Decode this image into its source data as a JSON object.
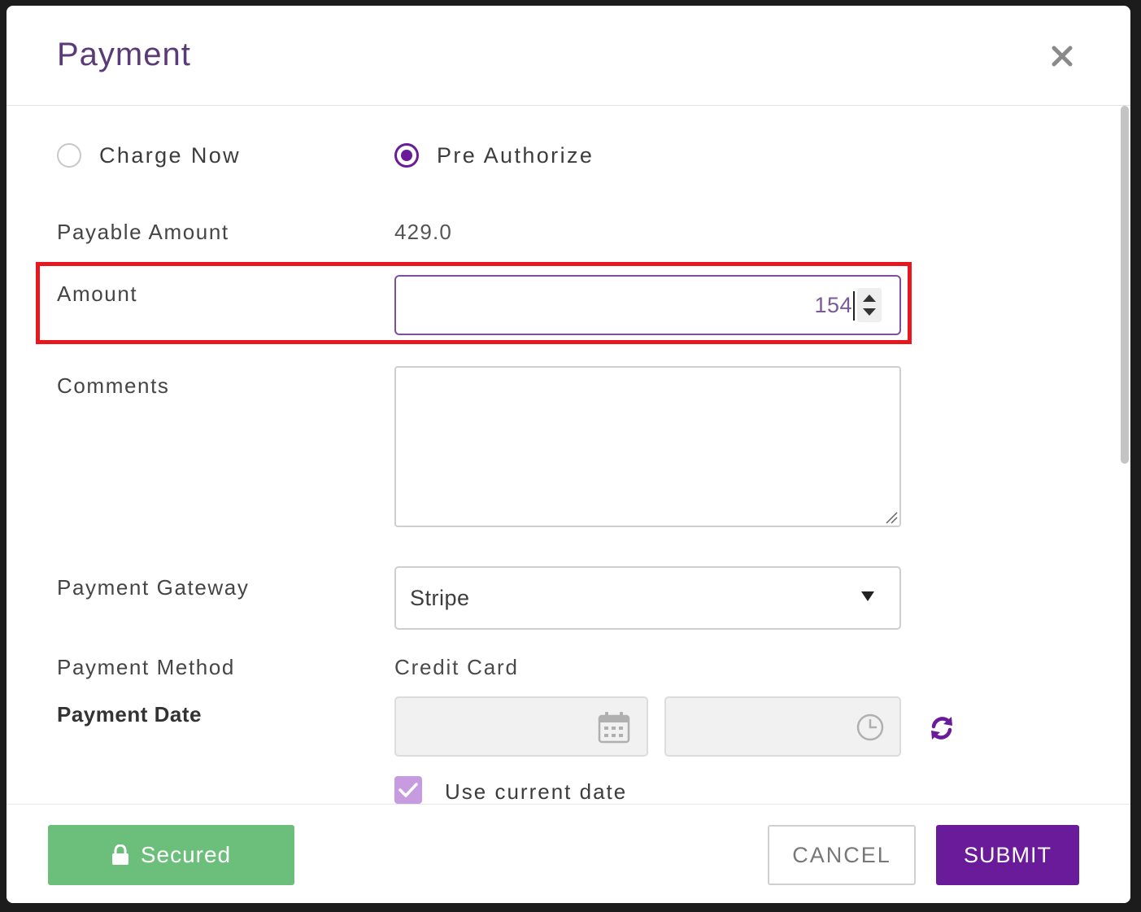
{
  "dialog": {
    "title": "Payment"
  },
  "charge_options": [
    {
      "label": "Charge Now",
      "selected": false
    },
    {
      "label": "Pre Authorize",
      "selected": true
    }
  ],
  "payable_amount": {
    "label": "Payable Amount",
    "value": "429.0"
  },
  "amount": {
    "label": "Amount",
    "value": "154"
  },
  "comments": {
    "label": "Comments",
    "value": ""
  },
  "payment_gateway": {
    "label": "Payment Gateway",
    "selected": "Stripe"
  },
  "payment_method": {
    "label": "Payment Method",
    "value": "Credit Card"
  },
  "payment_date": {
    "label": "Payment Date",
    "date": "",
    "time": ""
  },
  "use_current_date": {
    "label": "Use current date",
    "checked": true
  },
  "footer": {
    "secured_label": "Secured",
    "cancel_label": "CANCEL",
    "submit_label": "SUBMIT"
  },
  "colors": {
    "accent": "#6a1b9a",
    "secured": "#6cbf7b",
    "highlight": "#e8161d"
  },
  "icons": [
    "close-icon",
    "calendar-icon",
    "clock-icon",
    "refresh-icon",
    "lock-icon",
    "dropdown-arrow-icon",
    "checkmark-icon"
  ]
}
